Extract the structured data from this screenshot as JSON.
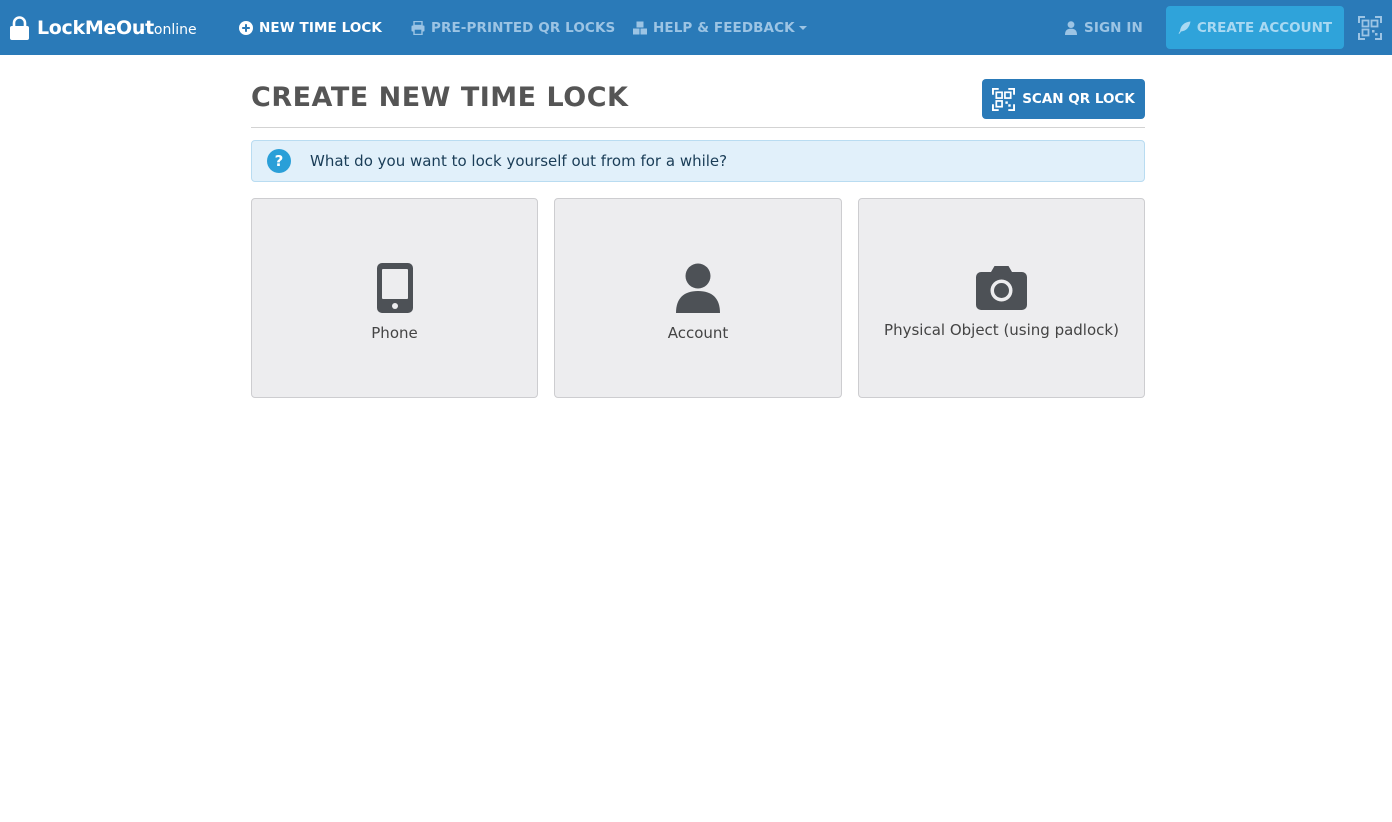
{
  "brand": {
    "main": "LockMeOut",
    "sub": "online"
  },
  "nav": {
    "new_time_lock": "NEW TIME LOCK",
    "pre_printed": "PRE-PRINTED QR LOCKS",
    "help": "HELP & FEEDBACK",
    "sign_in": "SIGN IN",
    "create_account": "CREATE ACCOUNT"
  },
  "page": {
    "title": "CREATE NEW TIME LOCK",
    "scan_button": "SCAN QR LOCK",
    "prompt": "What do you want to lock yourself out from for a while?"
  },
  "options": [
    {
      "label": "Phone",
      "icon": "phone-icon"
    },
    {
      "label": "Account",
      "icon": "user-icon"
    },
    {
      "label": "Physical Object (using padlock)",
      "icon": "camera-icon"
    }
  ],
  "colors": {
    "navbar": "#2a7ab8",
    "create_account_bg": "#2fa3da",
    "alert_bg": "#e1f0fa",
    "card_bg": "#ededef"
  }
}
